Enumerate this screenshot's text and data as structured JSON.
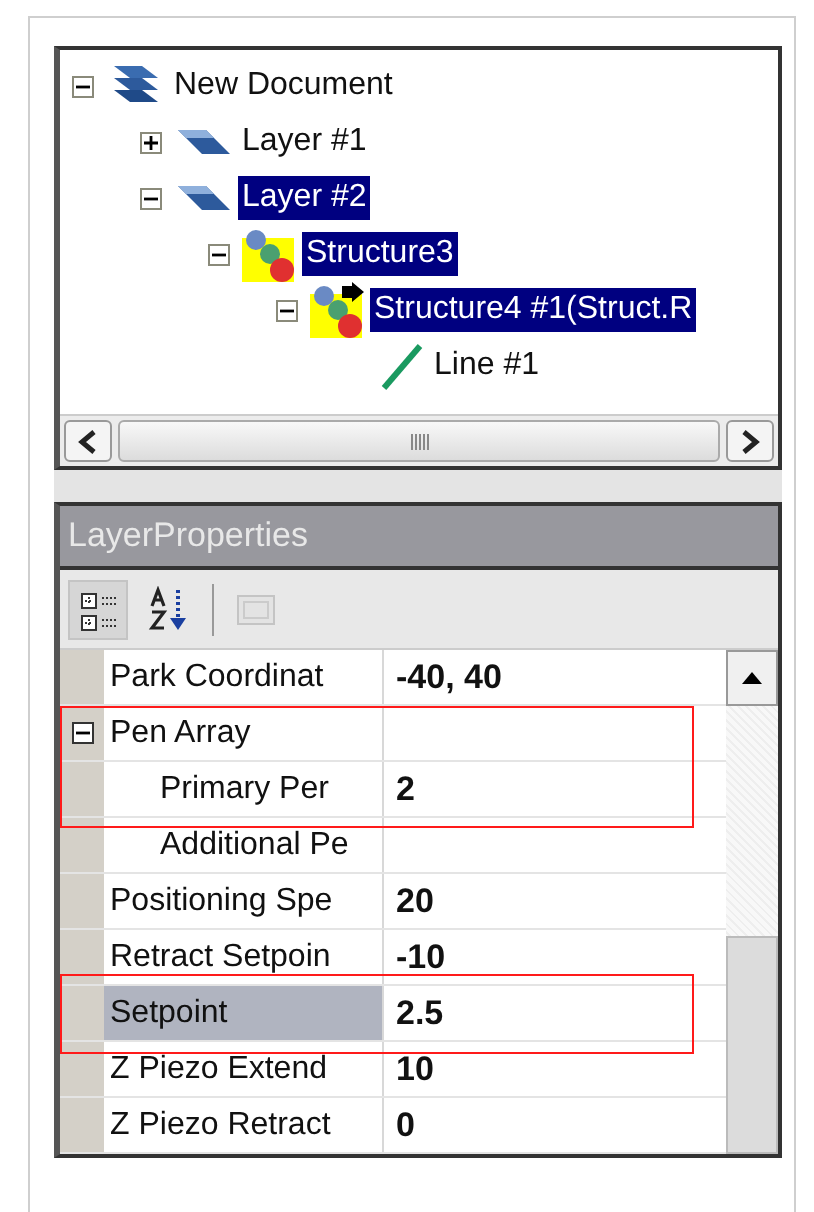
{
  "tree": {
    "nodes": [
      {
        "label": "New Document",
        "kind": "document",
        "expanded": true,
        "selected": false,
        "children": [
          {
            "label": "Layer #1",
            "kind": "layer",
            "expanded": false,
            "selected": false
          },
          {
            "label": "Layer #2",
            "kind": "layer",
            "expanded": true,
            "selected": true,
            "children": [
              {
                "label": "Structure3",
                "kind": "structure",
                "expanded": true,
                "selected": true,
                "children": [
                  {
                    "label": "Structure4 #1(Struct.R",
                    "kind": "structure_ref",
                    "expanded": true,
                    "selected": true,
                    "children": [
                      {
                        "label": "Line #1",
                        "kind": "line",
                        "selected": false
                      }
                    ]
                  }
                ]
              }
            ]
          }
        ]
      }
    ]
  },
  "properties": {
    "title": "LayerProperties",
    "toolbar": [
      {
        "kind": "categorized",
        "selected": true,
        "disabled": false
      },
      {
        "kind": "alphabetical",
        "selected": false,
        "disabled": false
      },
      {
        "kind": "pages",
        "selected": false,
        "disabled": true
      }
    ],
    "rows": [
      {
        "name": "Park Coordinat",
        "value": "-40,  40",
        "selected": false,
        "boxed": false
      },
      {
        "name": "Pen Array",
        "kind": "category",
        "expanded": true,
        "selected": false,
        "boxed": true,
        "children": [
          {
            "name": "Primary Per",
            "value": "2",
            "selected": false,
            "boxed": true
          },
          {
            "name": "Additional Pe",
            "selected": false,
            "boxed": false
          }
        ]
      },
      {
        "name": "Positioning Spe",
        "value": "20",
        "selected": false,
        "boxed": false
      },
      {
        "name": "Retract Setpoin",
        "value": "-10",
        "selected": false,
        "boxed": false
      },
      {
        "name": "Setpoint",
        "value": "2.5",
        "selected": true,
        "boxed": true
      },
      {
        "name": "Z Piezo Extend",
        "value": "10",
        "selected": false,
        "boxed": false
      },
      {
        "name": "Z Piezo Retract",
        "value": "0",
        "selected": false,
        "boxed": false
      }
    ]
  }
}
